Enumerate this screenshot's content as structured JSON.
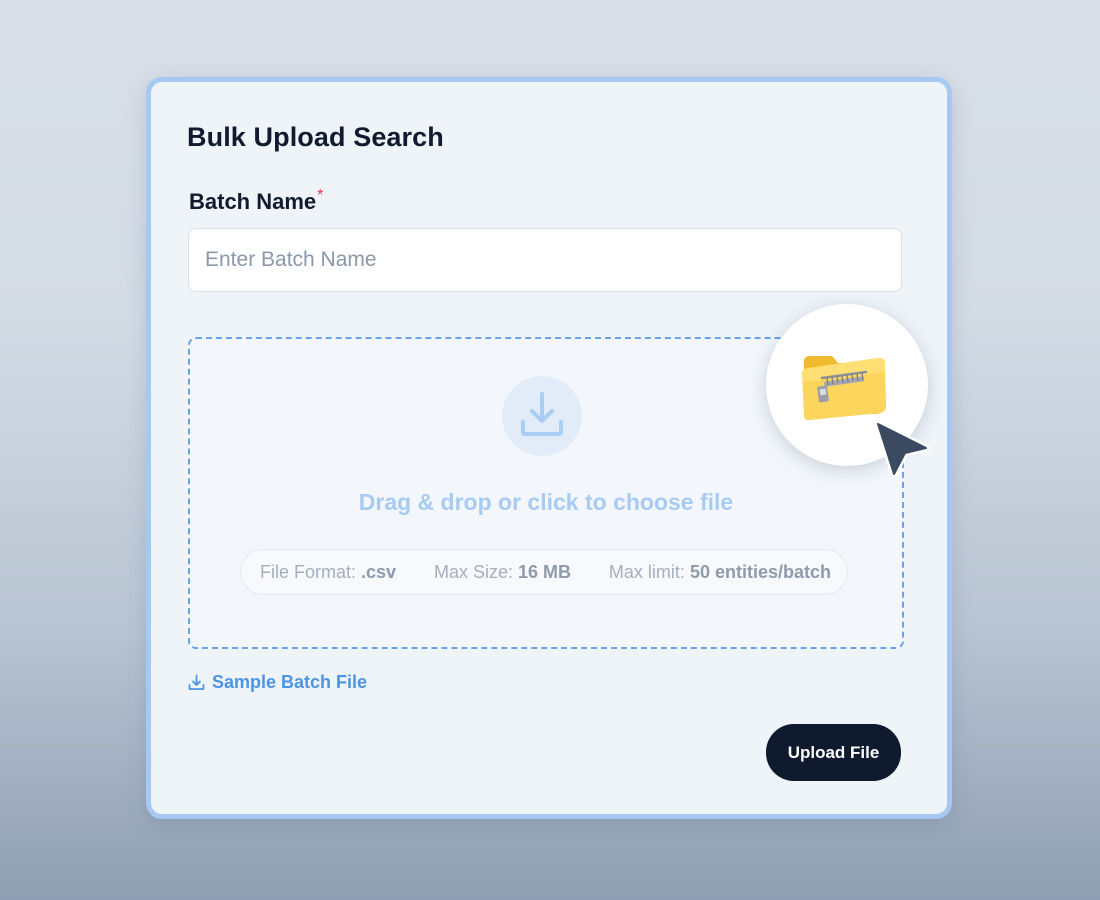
{
  "form": {
    "title": "Bulk Upload Search",
    "batch_name_label": "Batch Name",
    "required_mark": "*",
    "batch_name_placeholder": "Enter Batch Name",
    "batch_name_value": ""
  },
  "dropzone": {
    "upload_icon": "download-tray-icon",
    "prompt": "Drag & drop or click to choose file",
    "file_format_label": "File Format:",
    "file_format_value": ".csv",
    "max_size_label": "Max Size:",
    "max_size_value": "16 MB",
    "max_limit_label": "Max limit:",
    "max_limit_value": "50 entities/batch"
  },
  "sample_link": {
    "icon": "download-icon",
    "label": "Sample Batch File"
  },
  "actions": {
    "upload_label": "Upload File"
  },
  "overlay": {
    "file_icon": "zip-folder-icon",
    "cursor_icon": "cursor-arrow-icon"
  },
  "colors": {
    "accent": "#4b94e6",
    "card_border": "#a6c8f2",
    "primary_button": "#0f1a2f",
    "required": "#e8344b",
    "drop_text": "#a8cbf4"
  }
}
